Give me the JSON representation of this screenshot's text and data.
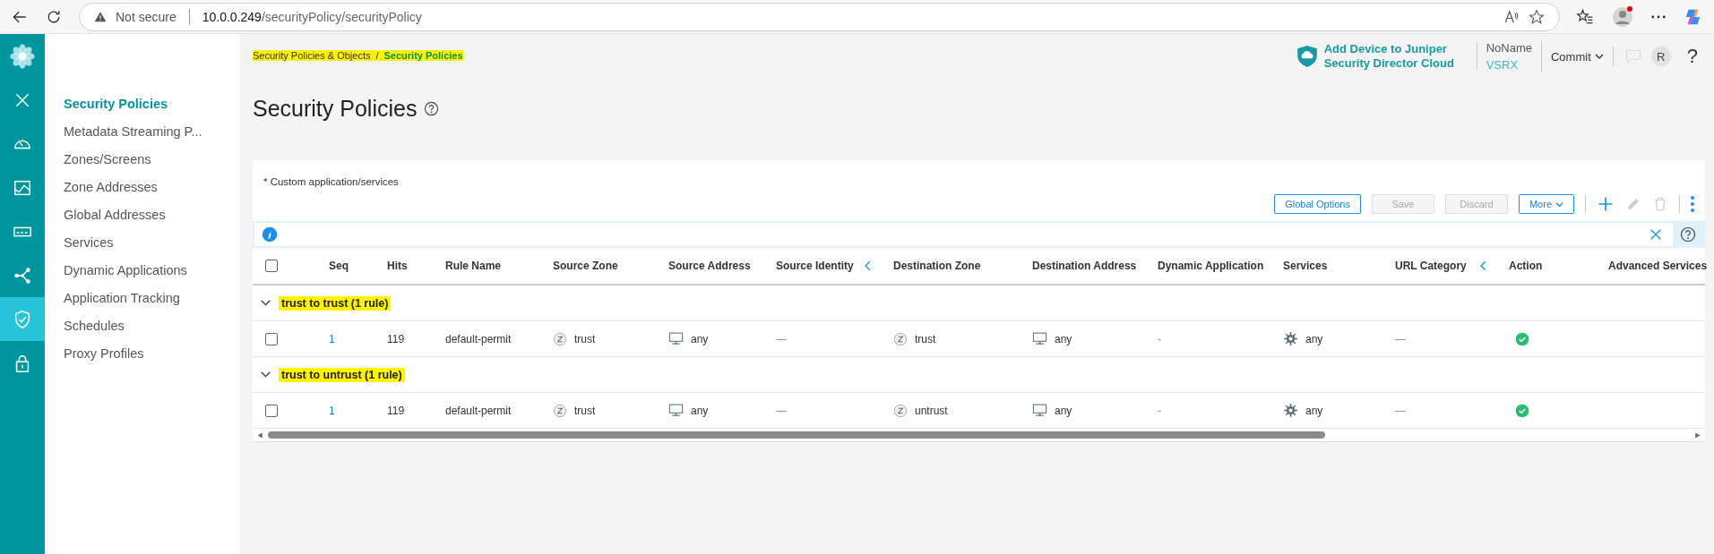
{
  "browser": {
    "security_label": "Not secure",
    "url_host": "10.0.0.249",
    "url_path": "/securityPolicy/securityPolicy"
  },
  "rail_items": [
    {
      "selected": false
    },
    {
      "selected": false
    },
    {
      "selected": false
    },
    {
      "selected": false
    },
    {
      "selected": false
    },
    {
      "selected": false
    },
    {
      "selected": true
    },
    {
      "selected": false
    }
  ],
  "sidebar": {
    "items": [
      {
        "label": "Security Policies",
        "selected": true
      },
      {
        "label": "Metadata Streaming P...",
        "selected": false
      },
      {
        "label": "Zones/Screens",
        "selected": false
      },
      {
        "label": "Zone Addresses",
        "selected": false
      },
      {
        "label": "Global Addresses",
        "selected": false
      },
      {
        "label": "Services",
        "selected": false
      },
      {
        "label": "Dynamic Applications",
        "selected": false
      },
      {
        "label": "Application Tracking",
        "selected": false
      },
      {
        "label": "Schedules",
        "selected": false
      },
      {
        "label": "Proxy Profiles",
        "selected": false
      }
    ]
  },
  "breadcrumb": {
    "highlighted": true,
    "separator": "/",
    "items": [
      {
        "label": "Security Policies & Objects",
        "current": false
      },
      {
        "label": "Security Policies",
        "current": true
      }
    ]
  },
  "header": {
    "promo": "Add Device to Juniper Security Director Cloud",
    "device_name": "NoName",
    "device_model": "VSRX",
    "commit": "Commit",
    "avatar": "R",
    "help": "?"
  },
  "page_title": "Security Policies",
  "card": {
    "note": "* Custom application/services",
    "buttons": [
      {
        "label": "Global Options",
        "disabled": false,
        "kind": "plain"
      },
      {
        "label": "Save",
        "disabled": true,
        "kind": "plain"
      },
      {
        "label": "Discard",
        "disabled": true,
        "kind": "plain"
      },
      {
        "label": "More",
        "disabled": false,
        "kind": "dropdown"
      }
    ]
  },
  "table": {
    "select_all_checked": false,
    "columns": [
      {
        "label": "Seq",
        "collapse": false
      },
      {
        "label": "Hits",
        "collapse": false
      },
      {
        "label": "Rule Name",
        "collapse": false
      },
      {
        "label": "Source Zone",
        "collapse": false
      },
      {
        "label": "Source Address",
        "collapse": false
      },
      {
        "label": "Source Identity",
        "collapse": true
      },
      {
        "label": "Destination Zone",
        "collapse": false
      },
      {
        "label": "Destination Address",
        "collapse": false
      },
      {
        "label": "Dynamic Application",
        "collapse": false
      },
      {
        "label": "Services",
        "collapse": false
      },
      {
        "label": "URL Category",
        "collapse": true
      },
      {
        "label": "Action",
        "collapse": false
      },
      {
        "label": "Advanced Services",
        "collapse": false
      }
    ],
    "groups": [
      {
        "title": "trust to trust (1 rule)",
        "expanded": true,
        "highlighted": true,
        "rows": [
          {
            "checked": false,
            "seq": "1",
            "hits": "119",
            "rule_name": "default-permit",
            "source_zone": "trust",
            "source_address": "any",
            "source_identity": "—",
            "destination_zone": "trust",
            "destination_address": "any",
            "dynamic_application": "-",
            "services": "any",
            "url_category": "—"
          }
        ]
      },
      {
        "title": "trust to untrust (1 rule)",
        "expanded": true,
        "highlighted": true,
        "rows": [
          {
            "checked": false,
            "seq": "1",
            "hits": "119",
            "rule_name": "default-permit",
            "source_zone": "trust",
            "source_address": "any",
            "source_identity": "—",
            "destination_zone": "untrust",
            "destination_address": "any",
            "dynamic_application": "-",
            "services": "any",
            "url_category": "—"
          }
        ]
      }
    ]
  }
}
